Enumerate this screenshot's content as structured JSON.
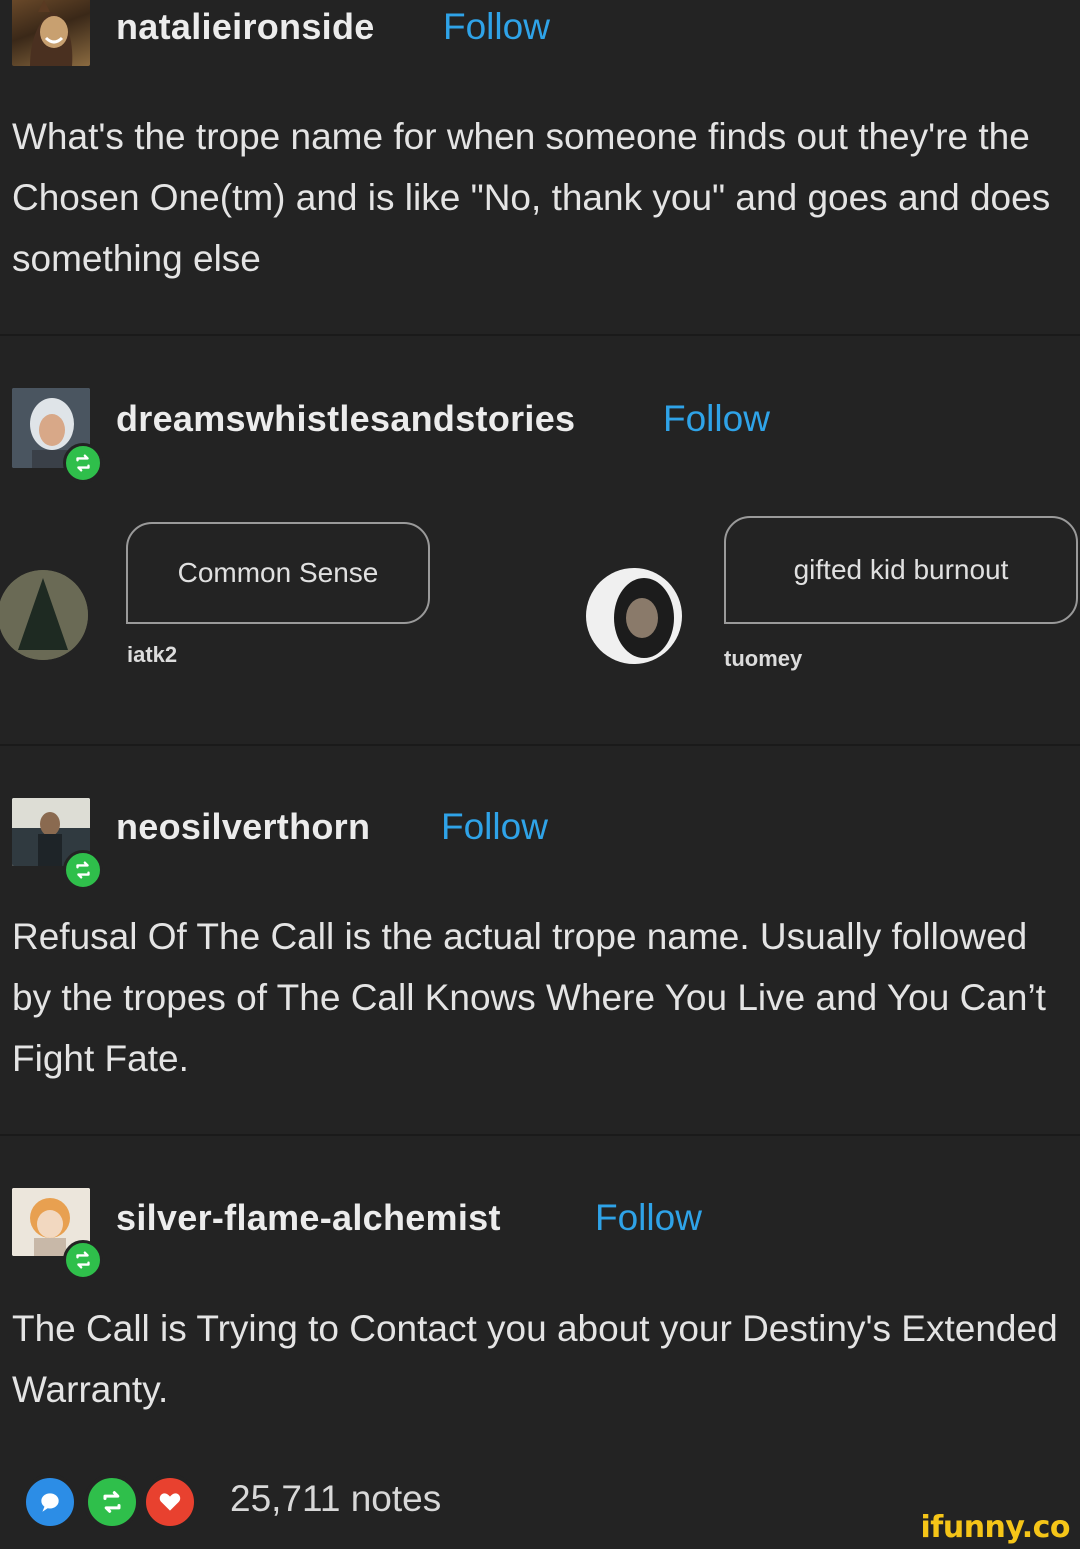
{
  "posts": [
    {
      "username": "natalieironside",
      "follow": "Follow",
      "text": "What's the trope name for when someone finds out they're the Chosen One(tm) and is like \"No, thank you\" and goes and does something else"
    },
    {
      "username": "dreamswhistlesandstories",
      "follow": "Follow",
      "dialog": {
        "left_bubble": "Common Sense",
        "left_name": "iatk2",
        "right_bubble": "gifted kid burnout",
        "right_name": "tuomey"
      }
    },
    {
      "username": "neosilverthorn",
      "follow": "Follow",
      "text": "Refusal Of The Call is the actual trope name.  Usually followed by the tropes of The Call Knows Where You Live and You Can’t Fight Fate."
    },
    {
      "username": "silver-flame-alchemist",
      "follow": "Follow",
      "text": "The Call is Trying to Contact you about your Destiny's Extended Warranty."
    }
  ],
  "notes": {
    "count": "25,711 notes"
  },
  "watermark": "ifunny.co",
  "colors": {
    "background": "#232323",
    "follow": "#2fa3e8",
    "reblog": "#2fbf4b",
    "like": "#e8412f",
    "reply": "#2c8de6"
  },
  "icons": [
    "reblog-icon",
    "reply-icon",
    "heart-icon"
  ]
}
